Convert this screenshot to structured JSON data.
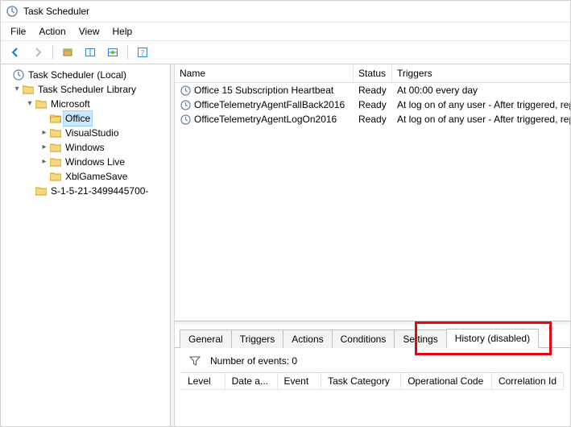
{
  "window": {
    "title": "Task Scheduler"
  },
  "menu": [
    "File",
    "Action",
    "View",
    "Help"
  ],
  "tree": {
    "root": "Task Scheduler (Local)",
    "lib": "Task Scheduler Library",
    "microsoft": "Microsoft",
    "office": "Office",
    "visualstudio": "VisualStudio",
    "windows": "Windows",
    "windowslive": "Windows Live",
    "xblgamesave": "XblGameSave",
    "sid": "S-1-5-21-3499445700-"
  },
  "columns": {
    "name": "Name",
    "status": "Status",
    "triggers": "Triggers"
  },
  "tasks": [
    {
      "name": "Office 15 Subscription Heartbeat",
      "status": "Ready",
      "triggers": "At 00:00 every day"
    },
    {
      "name": "OfficeTelemetryAgentFallBack2016",
      "status": "Ready",
      "triggers": "At log on of any user - After triggered, repeat eve"
    },
    {
      "name": "OfficeTelemetryAgentLogOn2016",
      "status": "Ready",
      "triggers": "At log on of any user - After triggered, repeat eve"
    }
  ],
  "tabs": {
    "general": "General",
    "triggers": "Triggers",
    "actions": "Actions",
    "conditions": "Conditions",
    "settings": "Settings",
    "history": "History (disabled)"
  },
  "history": {
    "events_label": "Number of events: 0",
    "cols": {
      "level": "Level",
      "date": "Date a...",
      "event": "Event",
      "category": "Task Category",
      "opcode": "Operational Code",
      "corr": "Correlation Id"
    }
  }
}
